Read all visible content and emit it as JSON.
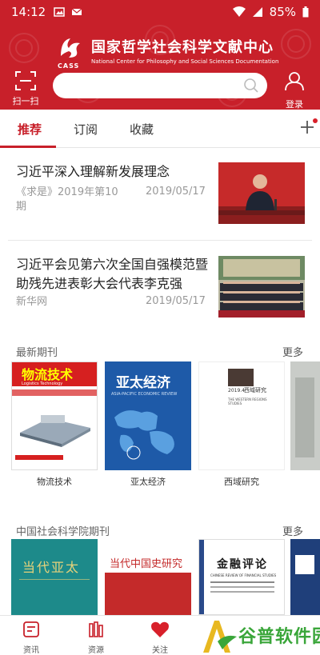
{
  "status": {
    "time": "14:12",
    "battery": "85%"
  },
  "header": {
    "org_cn": "国家哲学社会科学文献中心",
    "org_en": "National Center for Philosophy and Social Sciences Documentation",
    "logo_text": "CASS",
    "scan_label": "扫一扫",
    "login_label": "登录",
    "search_placeholder": "",
    "brand_color": "#c8202a"
  },
  "tabs": [
    {
      "label": "推荐",
      "active": true
    },
    {
      "label": "订阅",
      "active": false
    },
    {
      "label": "收藏",
      "active": false
    }
  ],
  "news": [
    {
      "title": "习近平深入理解新发展理念",
      "source": "《求是》2019年第10期",
      "date": "2019/05/17"
    },
    {
      "title": "习近平会见第六次全国自强模范暨助残先进表彰大会代表李克强",
      "source": "新华网",
      "date": "2019/05/17"
    }
  ],
  "sections": {
    "latest_journals": {
      "title": "最新期刊",
      "more": "更多",
      "items": [
        {
          "label": "物流技术",
          "cover_title": "物流技术",
          "cover_subtitle": "Logistics Technology"
        },
        {
          "label": "亚太经济",
          "cover_title": "亚太经济",
          "cover_subtitle": "ASIA-PACIFIC ECONOMIC REVIEW"
        },
        {
          "label": "西域研究",
          "cover_title": "西域研究",
          "cover_subtitle": "THE WESTERN REGIONS STUDIES",
          "cover_issue": "2019.4"
        }
      ]
    },
    "cass_journals": {
      "title": "中国社会科学院期刊",
      "more": "更多",
      "items": [
        {
          "cover_title": "当代亚太"
        },
        {
          "cover_title": "当代中国史研究"
        },
        {
          "cover_title": "金融评论",
          "cover_subtitle": "CHINESE REVIEW OF FINANCIAL STUDIES"
        }
      ]
    }
  },
  "bottom_nav": [
    {
      "label": "资讯",
      "icon": "news-icon"
    },
    {
      "label": "资源",
      "icon": "books-icon"
    },
    {
      "label": "关注",
      "icon": "heart-icon"
    }
  ],
  "watermark": {
    "text": "谷普软件园"
  }
}
